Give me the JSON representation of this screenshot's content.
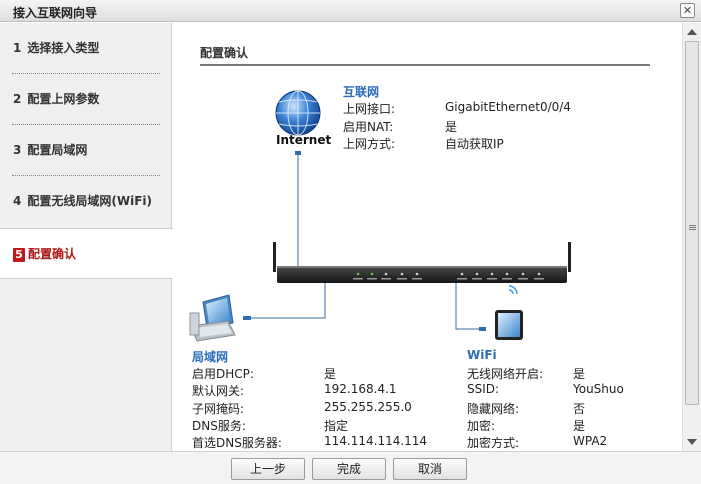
{
  "window": {
    "title": "接入互联网向导",
    "close_glyph": "✕"
  },
  "sidebar": {
    "items": [
      {
        "num": "1",
        "label": "选择接入类型"
      },
      {
        "num": "2",
        "label": "配置上网参数"
      },
      {
        "num": "3",
        "label": "配置局域网"
      },
      {
        "num": "4",
        "label": "配置无线局域网(WiFi)"
      },
      {
        "num": "5",
        "label": "配置确认"
      }
    ],
    "active_index": 4
  },
  "main": {
    "heading": "配置确认",
    "internet": {
      "icon_label": "Internet",
      "title": "互联网",
      "rows": [
        {
          "key": "上网接口:",
          "value": "GigabitEthernet0/0/4"
        },
        {
          "key": "启用NAT:",
          "value": "是"
        },
        {
          "key": "上网方式:",
          "value": "自动获取IP"
        }
      ]
    },
    "lan": {
      "title": "局域网",
      "rows": [
        {
          "key": "启用DHCP:",
          "value": "是"
        },
        {
          "key": "默认网关:",
          "value": "192.168.4.1"
        },
        {
          "key": "子网掩码:",
          "value": "255.255.255.0"
        },
        {
          "key": "DNS服务:",
          "value": "指定"
        },
        {
          "key": "首选DNS服务器:",
          "value": "114.114.114.114"
        }
      ]
    },
    "wifi": {
      "title": "WiFi",
      "rows": [
        {
          "key": "无线网络开启:",
          "value": "是"
        },
        {
          "key": "SSID:",
          "value": "YouShuo"
        },
        {
          "key": "隐藏网络:",
          "value": "否"
        },
        {
          "key": "加密:",
          "value": "是"
        },
        {
          "key": "加密方式:",
          "value": "WPA2"
        }
      ]
    }
  },
  "footer": {
    "prev_label": "上一步",
    "finish_label": "完成",
    "cancel_label": "取消"
  },
  "colors": {
    "accent_blue": "#2b6cb8",
    "active_red": "#c01818",
    "connector": "#3a6ea5"
  }
}
